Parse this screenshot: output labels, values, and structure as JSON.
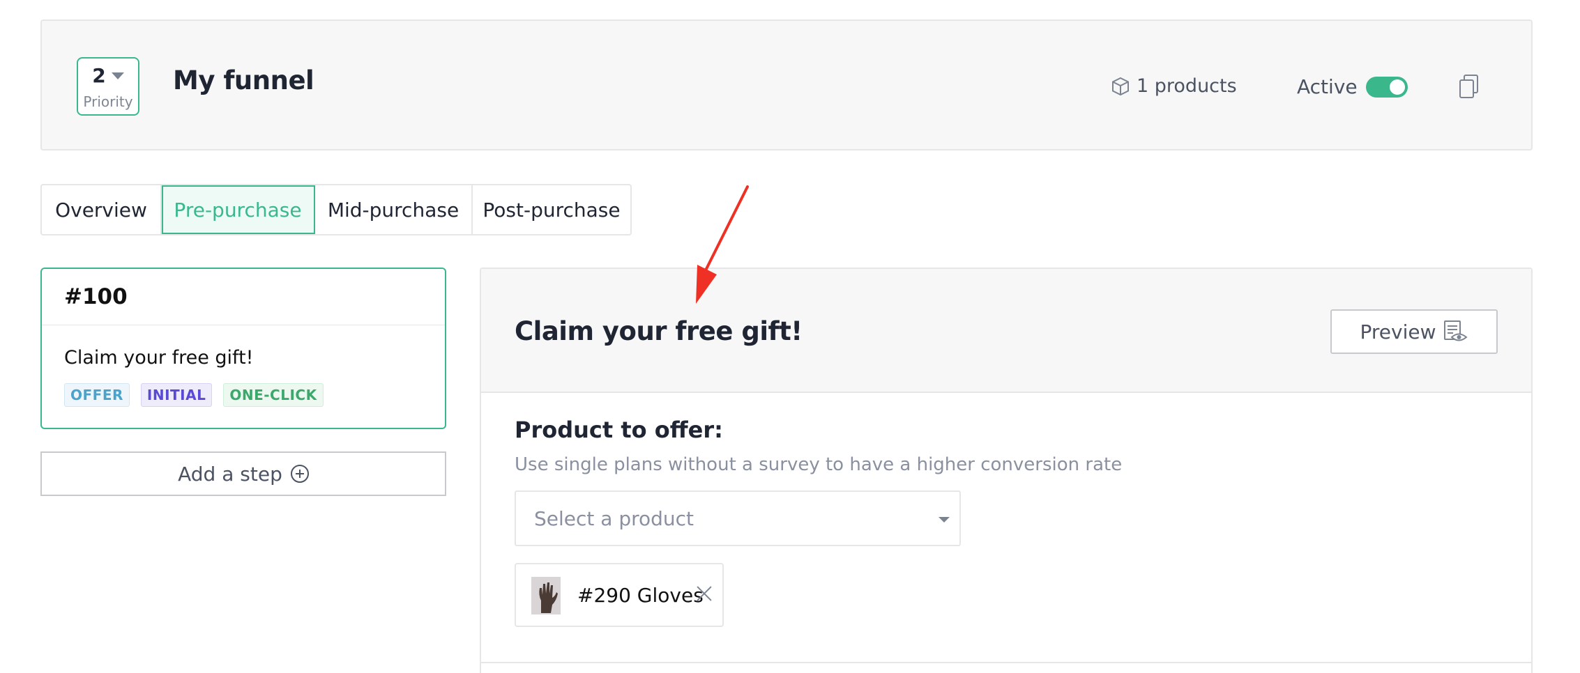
{
  "header": {
    "priority_value": "2",
    "priority_label": "Priority",
    "funnel_title": "My funnel",
    "products_label": "1 products",
    "status_label": "Active",
    "status_on": true,
    "icons": [
      "box-icon",
      "copy-icon"
    ]
  },
  "tabs": [
    {
      "label": "Overview",
      "active": false
    },
    {
      "label": "Pre-purchase",
      "active": true
    },
    {
      "label": "Mid-purchase",
      "active": false
    },
    {
      "label": "Post-purchase",
      "active": false
    }
  ],
  "steps": [
    {
      "id": "#100",
      "title": "Claim your free gift!",
      "badges": [
        "OFFER",
        "INITIAL",
        "ONE-CLICK"
      ]
    }
  ],
  "add_step_label": "Add a step",
  "panel": {
    "title": "Claim your free gift!",
    "preview_label": "Preview",
    "product_section_label": "Product to offer:",
    "product_help": "Use single plans without a survey to have a higher conversion rate",
    "select_placeholder": "Select a product",
    "selected_product": "#290 Gloves"
  },
  "colors": {
    "accent": "#3ab88c",
    "annotation_arrow": "#ee3124"
  }
}
